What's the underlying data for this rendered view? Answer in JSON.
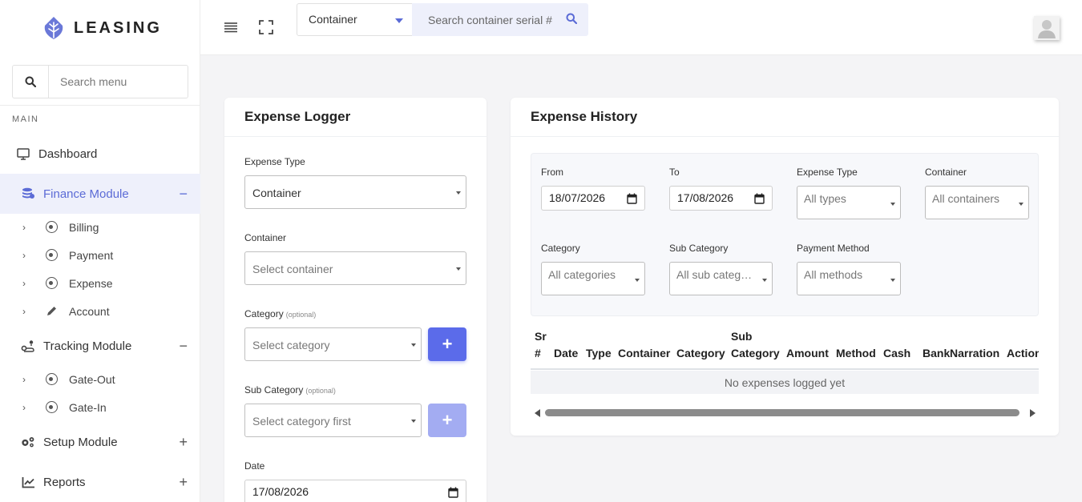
{
  "brand": {
    "name": "LEASING"
  },
  "sidebar": {
    "search_placeholder": "Search menu",
    "section_label": "MAIN",
    "dashboard": "Dashboard",
    "finance": {
      "label": "Finance Module",
      "toggle": "−",
      "items": [
        "Billing",
        "Payment",
        "Expense",
        "Account"
      ]
    },
    "tracking": {
      "label": "Tracking Module",
      "toggle": "−",
      "items": [
        "Gate-Out",
        "Gate-In"
      ]
    },
    "setup": {
      "label": "Setup Module",
      "toggle": "+"
    },
    "reports": {
      "label": "Reports",
      "toggle": "+"
    }
  },
  "topbar": {
    "search_type": "Container",
    "search_placeholder": "Search container serial #"
  },
  "logger": {
    "title": "Expense Logger",
    "expense_type_label": "Expense Type",
    "expense_type_value": "Container",
    "container_label": "Container",
    "container_placeholder": "Select container",
    "category_label": "Category",
    "optional": "(optional)",
    "category_placeholder": "Select category",
    "subcategory_label": "Sub Category",
    "subcategory_placeholder": "Select category first",
    "date_label": "Date",
    "date_value": "17/08/2026",
    "plus": "+"
  },
  "history": {
    "title": "Expense History",
    "filters": {
      "from_label": "From",
      "from_value": "18/07/2026",
      "to_label": "To",
      "to_value": "17/08/2026",
      "expense_type_label": "Expense Type",
      "expense_type_value": "All types",
      "container_label": "Container",
      "container_value": "All containers",
      "category_label": "Category",
      "category_value": "All categories",
      "subcategory_label": "Sub Category",
      "subcategory_value": "All sub categories",
      "method_label": "Payment Method",
      "method_value": "All methods"
    },
    "columns": [
      "Sr #",
      "Date",
      "Type",
      "Container",
      "Category",
      "Sub Category",
      "Amount",
      "Method",
      "Cash",
      "Bank",
      "Narration",
      "Actions"
    ],
    "empty_text": "No expenses logged yet"
  },
  "colors": {
    "accent": "#5b6bea",
    "active_bg": "#eef0fb"
  }
}
